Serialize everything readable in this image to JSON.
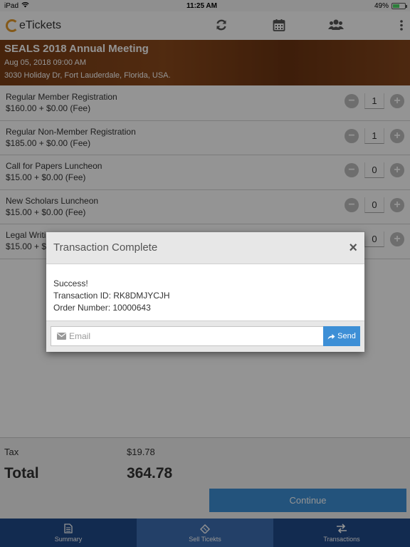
{
  "status_bar": {
    "device": "iPad",
    "time": "11:25 AM",
    "battery": "49%",
    "battery_level": 0.49
  },
  "header": {
    "app_name": "eTickets",
    "icons": [
      "refresh-icon",
      "calendar-icon",
      "users-icon",
      "more-vert-icon"
    ]
  },
  "event": {
    "title": "SEALS 2018 Annual Meeting",
    "date": "Aug 05, 2018 09:00 AM",
    "address": "3030 Holiday Dr, Fort Lauderdale, Florida, USA."
  },
  "tickets": [
    {
      "name": "Regular Member Registration",
      "price": "$160.00 + $0.00 (Fee)",
      "qty": "1"
    },
    {
      "name": "Regular Non-Member Registration",
      "price": "$185.00 + $0.00 (Fee)",
      "qty": "1"
    },
    {
      "name": "Call for Papers Luncheon",
      "price": "$15.00 + $0.00 (Fee)",
      "qty": "0"
    },
    {
      "name": "New Scholars Luncheon",
      "price": "$15.00 + $0.00 (Fee)",
      "qty": "0"
    },
    {
      "name": "Legal Writi",
      "price": "$15.00 + $",
      "qty": "0"
    }
  ],
  "totals": {
    "tax_label": "Tax",
    "tax_value": "$19.78",
    "total_label": "Total",
    "total_value": "364.78",
    "continue_label": "Continue"
  },
  "tabs": [
    {
      "label": "Summary",
      "icon": "document-icon",
      "active": false
    },
    {
      "label": "Sell Ticekts",
      "icon": "ticket-icon",
      "active": true
    },
    {
      "label": "Transactions",
      "icon": "exchange-icon",
      "active": false
    }
  ],
  "modal": {
    "title": "Transaction Complete",
    "close": "×",
    "success": "Success!",
    "transaction_id": "Transaction ID: RK8DMJYCJH",
    "order_number": "Order Number: 10000643",
    "email_placeholder": "Email",
    "email_value": "",
    "send_label": "Send"
  },
  "colors": {
    "accent": "#3d8fd6",
    "tabbar": "#1f4a8a",
    "tab_active": "#3d6fb3",
    "banner": "#7a3e16",
    "logo": "#e39a2c"
  }
}
